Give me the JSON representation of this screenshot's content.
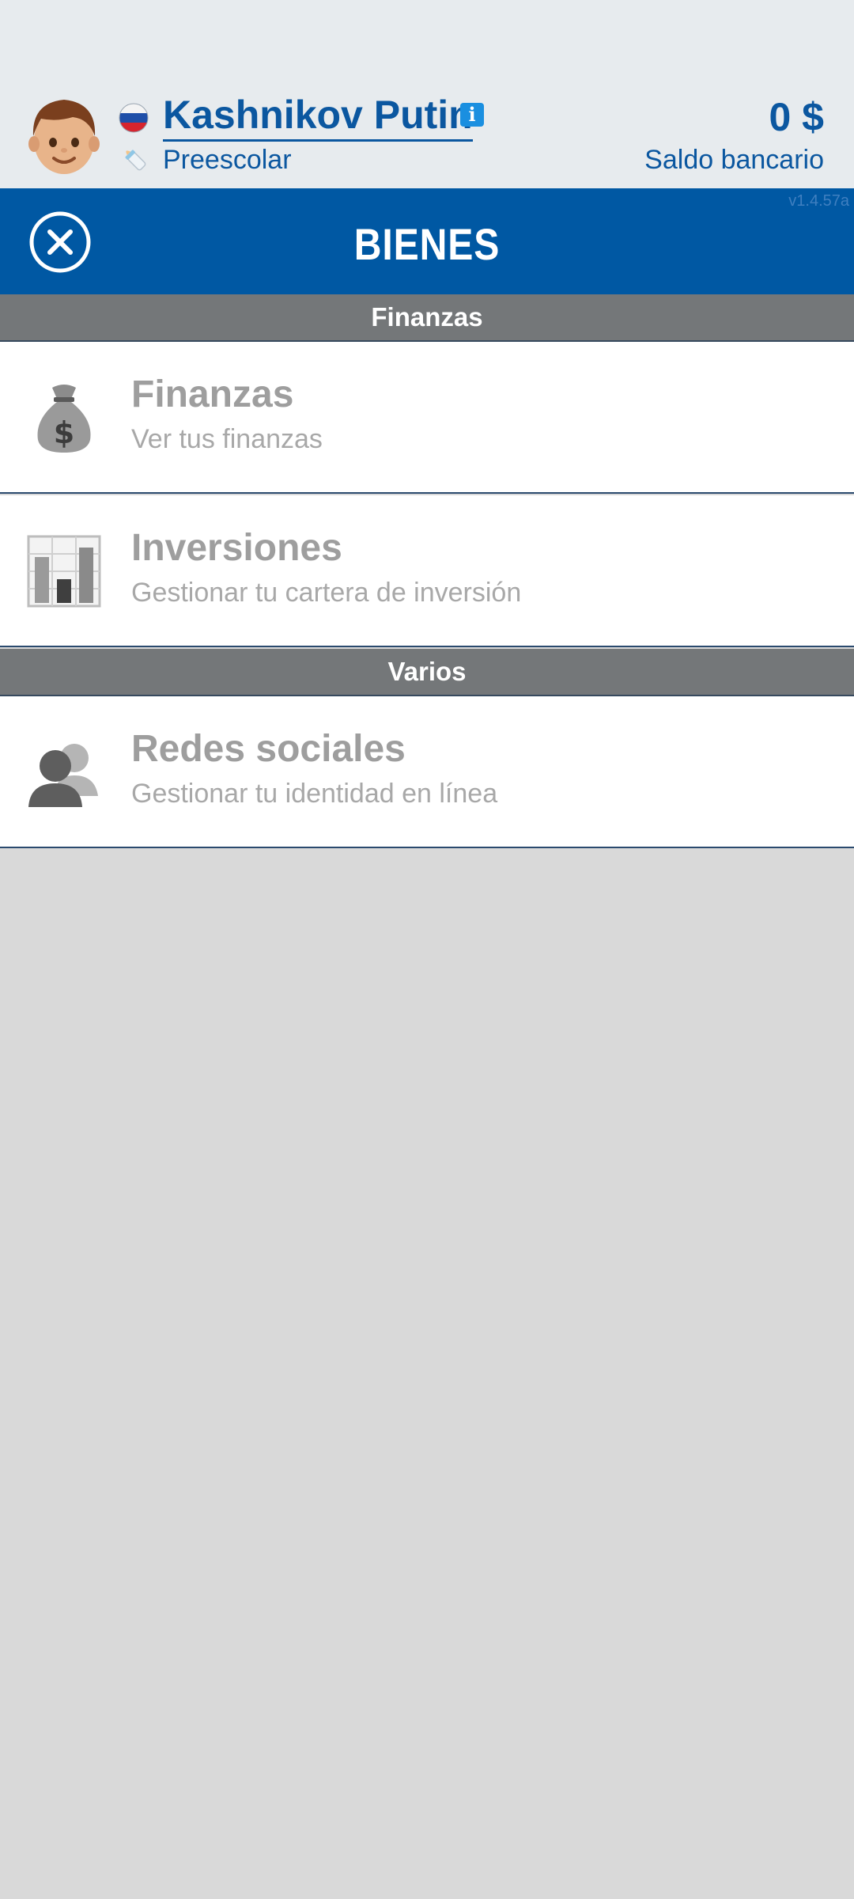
{
  "status": {
    "player_name": "Kashnikov Putin",
    "life_stage": "Preescolar",
    "balance": "0 $",
    "balance_label": "Saldo bancario"
  },
  "header": {
    "title": "BIENES",
    "version": "v1.4.57a"
  },
  "sections": [
    {
      "title": "Finanzas",
      "items": [
        {
          "title": "Finanzas",
          "subtitle": "Ver tus finanzas",
          "icon": "money-bag-icon"
        },
        {
          "title": "Inversiones",
          "subtitle": "Gestionar tu cartera de inversión",
          "icon": "bar-chart-icon"
        }
      ]
    },
    {
      "title": "Varios",
      "items": [
        {
          "title": "Redes sociales",
          "subtitle": "Gestionar tu identidad en línea",
          "icon": "people-icon"
        }
      ]
    }
  ],
  "icons": {
    "avatar": "boy-avatar-icon",
    "flag": "russia-flag-icon",
    "life_stage": "baby-bottle-icon",
    "info": "info-icon",
    "close": "close-icon"
  },
  "colors": {
    "top_bar": "#e7ebee",
    "header_blue": "#0058a3",
    "text_blue": "#0b57a0",
    "section_gray": "#747779",
    "background": "#d9d9d9"
  }
}
